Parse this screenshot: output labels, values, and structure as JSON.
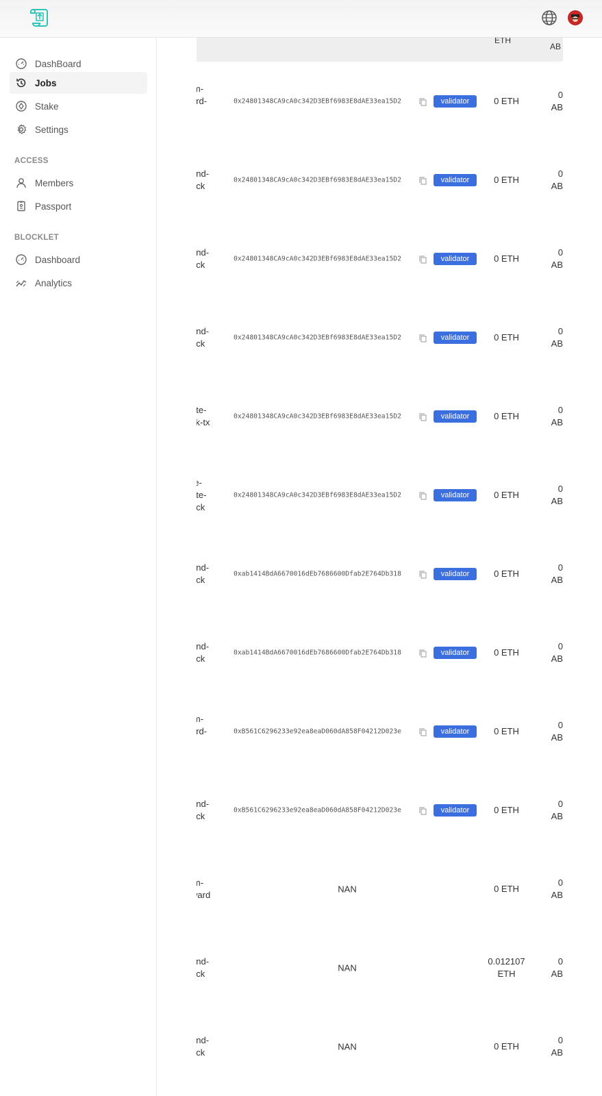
{
  "header": {
    "logo": "logo-icon",
    "language_icon": "globe-icon",
    "user_icon": "avatar"
  },
  "sidebar": {
    "items": [
      {
        "label": "DashBoard",
        "icon": "gauge-icon"
      },
      {
        "label": "Jobs",
        "icon": "history-icon",
        "active": true
      },
      {
        "label": "Stake",
        "icon": "stake-icon"
      },
      {
        "label": "Settings",
        "icon": "gear-icon"
      }
    ],
    "access_title": "ACCESS",
    "access_items": [
      {
        "label": "Members",
        "icon": "user-icon"
      },
      {
        "label": "Passport",
        "icon": "passport-icon"
      }
    ],
    "blocklet_title": "BLOCKLET",
    "blocklet_items": [
      {
        "label": "Dashboard",
        "icon": "gauge-icon"
      },
      {
        "label": "Analytics",
        "icon": "analytics-icon"
      }
    ]
  },
  "table": {
    "header": {
      "eth": "ETH",
      "ab": "AB"
    },
    "rows": [
      {
        "type": "im-\nard-\nx",
        "address": "0x24801348CA9cA0c342D3EBf6983E8dAE33ea15D2",
        "role": "validator",
        "eth": "0 ETH",
        "ab": "0\nAB"
      },
      {
        "type": "end-\nock",
        "address": "0x24801348CA9cA0c342D3EBf6983E8dAE33ea15D2",
        "role": "validator",
        "eth": "0 ETH",
        "ab": "0\nAB"
      },
      {
        "type": "end-\nock",
        "address": "0x24801348CA9cA0c342D3EBf6983E8dAE33ea15D2",
        "role": "validator",
        "eth": "0 ETH",
        "ab": "0\nAB"
      },
      {
        "type": "end-\nock",
        "address": "0x24801348CA9cA0c342D3EBf6983E8dAE33ea15D2",
        "role": "validator",
        "eth": "0 ETH",
        "ab": "0\nAB"
      },
      {
        "type": "ate-\nck-tx",
        "address": "0x24801348CA9cA0c342D3EBf6983E8dAE33ea15D2",
        "role": "validator",
        "eth": "0 ETH",
        "ab": "0\nAB"
      },
      {
        "type": "re-\nate-\nock",
        "address": "0x24801348CA9cA0c342D3EBf6983E8dAE33ea15D2",
        "role": "validator",
        "eth": "0 ETH",
        "ab": "0\nAB"
      },
      {
        "type": "end-\nock",
        "address": "0xab1414BdA6670016dEb7686600Dfab2E764Db318",
        "role": "validator",
        "eth": "0 ETH",
        "ab": "0\nAB"
      },
      {
        "type": "end-\nock",
        "address": "0xab1414BdA6670016dEb7686600Dfab2E764Db318",
        "role": "validator",
        "eth": "0 ETH",
        "ab": "0\nAB"
      },
      {
        "type": "im-\nard-\nx",
        "address": "0xB561C6296233e92ea8eaD060dA858F04212D023e",
        "role": "validator",
        "eth": "0 ETH",
        "ab": "0\nAB"
      },
      {
        "type": "end-\nock",
        "address": "0xB561C6296233e92ea8eaD060dA858F04212D023e",
        "role": "validator",
        "eth": "0 ETH",
        "ab": "0\nAB"
      },
      {
        "type": "im-\nward",
        "address": "NAN",
        "eth": "0 ETH",
        "ab": "0\nAB"
      },
      {
        "type": "end-\nock",
        "address": "NAN",
        "eth": "0.012107\nETH",
        "ab": "0\nAB"
      },
      {
        "type": "end-\nock",
        "address": "NAN",
        "eth": "0 ETH",
        "ab": "0\nAB"
      }
    ]
  }
}
